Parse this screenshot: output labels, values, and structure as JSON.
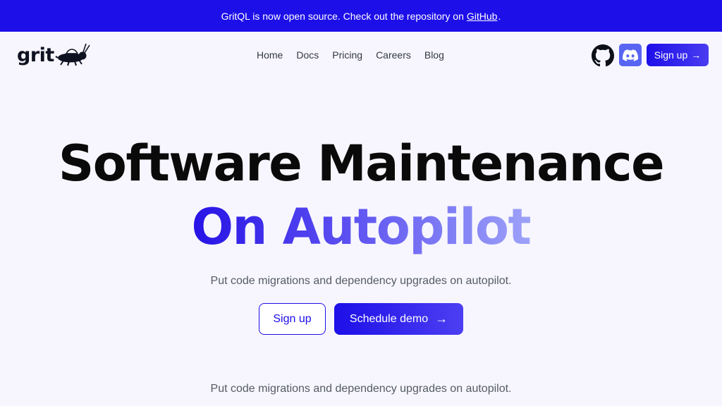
{
  "banner": {
    "text": "GritQL is now open source. Check out the repository on",
    "link_text": "GitHub",
    "trailing": "."
  },
  "nav": {
    "logo_text": "grit",
    "links": [
      {
        "label": "Home"
      },
      {
        "label": "Docs"
      },
      {
        "label": "Pricing"
      },
      {
        "label": "Careers"
      },
      {
        "label": "Blog"
      }
    ],
    "github_icon": "github-icon",
    "discord_icon": "discord-icon",
    "signup_label": "Sign up",
    "signup_arrow": "→"
  },
  "hero": {
    "title": "Software Maintenance",
    "accent": "On Autopilot",
    "subtitle": "Put code migrations and dependency upgrades on autopilot.",
    "signup_label": "Sign up",
    "demo_label": "Schedule demo",
    "demo_arrow": "→",
    "subtitle_repeat": "Put code migrations and dependency upgrades on autopilot."
  },
  "colors": {
    "brand": "#1d0fe8",
    "background": "#f7f6fe",
    "discord": "#5865f2"
  }
}
